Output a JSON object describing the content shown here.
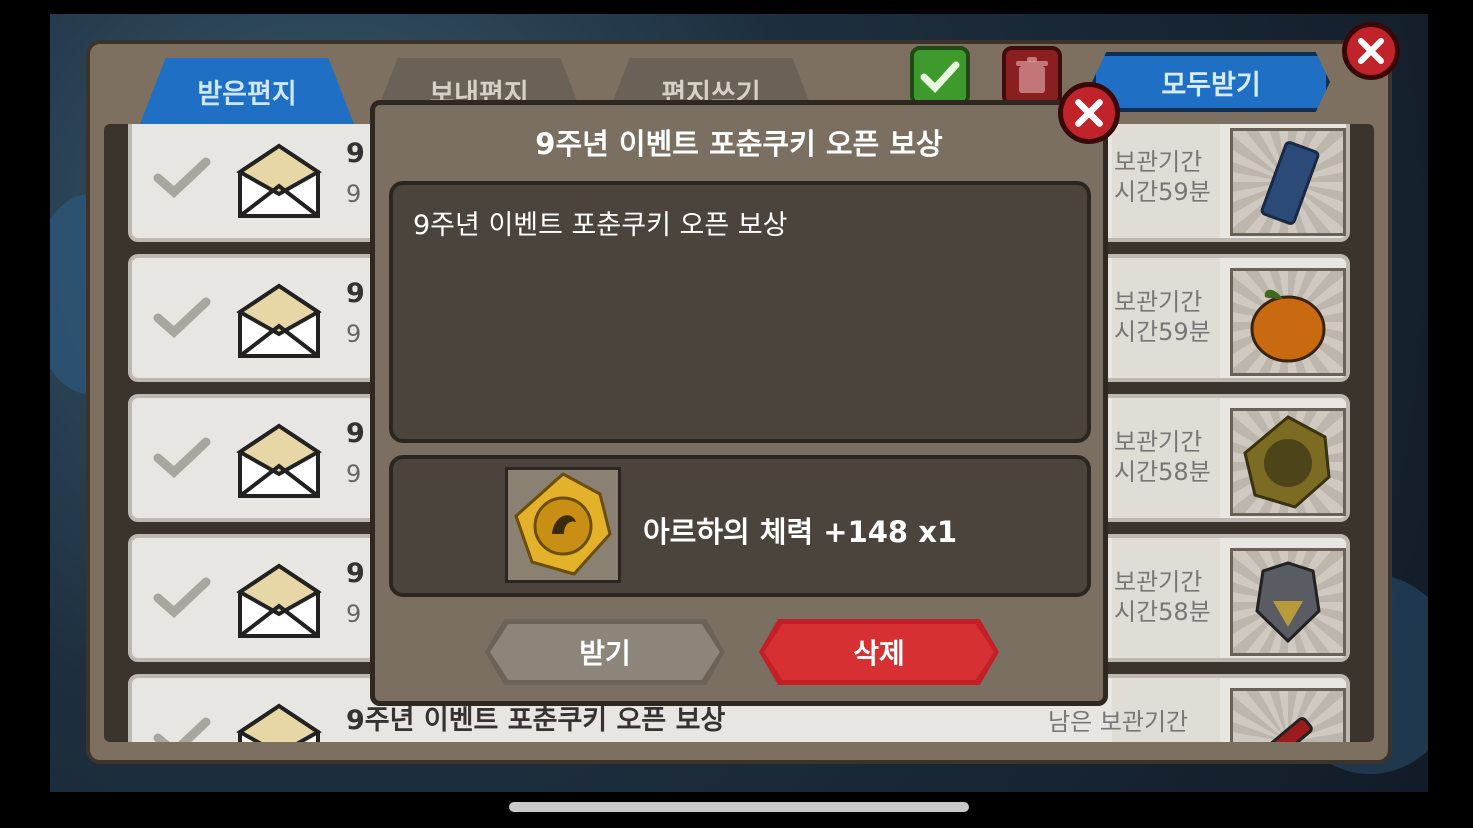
{
  "tabs": [
    {
      "label": "받은편지",
      "active": true
    },
    {
      "label": "보내편지",
      "active": false
    },
    {
      "label": "편지쓰기",
      "active": false
    }
  ],
  "toolbar": {
    "receive_all_label": "모두받기",
    "check_icon": "check-icon",
    "trash_icon": "trash-icon",
    "close_icon": "close-icon"
  },
  "mail_list": {
    "rows": [
      {
        "title": "9",
        "sub": "9",
        "remain_l1": "보관기간",
        "remain_l2": "시간59분",
        "item_icon": "ticket-icon"
      },
      {
        "title": "9",
        "sub": "9",
        "remain_l1": "보관기간",
        "remain_l2": "시간59분",
        "item_icon": "orange-fruit-icon"
      },
      {
        "title": "9",
        "sub": "9",
        "remain_l1": "보관기간",
        "remain_l2": "시간58분",
        "item_icon": "gold-medal-icon"
      },
      {
        "title": "9",
        "sub": "9",
        "remain_l1": "보관기간",
        "remain_l2": "시간58분",
        "item_icon": "armor-icon"
      },
      {
        "title": "9주년 이벤트 포춘쿠키 오픈 보상",
        "sub": "",
        "remain_l1": "남은 보관기간",
        "remain_l2": "",
        "item_icon": "syringe-icon"
      }
    ]
  },
  "modal": {
    "title": "9주년 이벤트 포춘쿠키 오픈 보상",
    "message": "9주년 이벤트 포춘쿠키 오픈 보상",
    "reward_text": "아르하의 체력 +148 x1",
    "reward_icon": "gold-medal-icon",
    "receive_label": "받기",
    "delete_label": "삭제"
  },
  "colors": {
    "tab_active": "#1f6fc4",
    "delete_button": "#c21f26",
    "close_button": "#c0242a",
    "modal_bg": "#7a6f60"
  }
}
